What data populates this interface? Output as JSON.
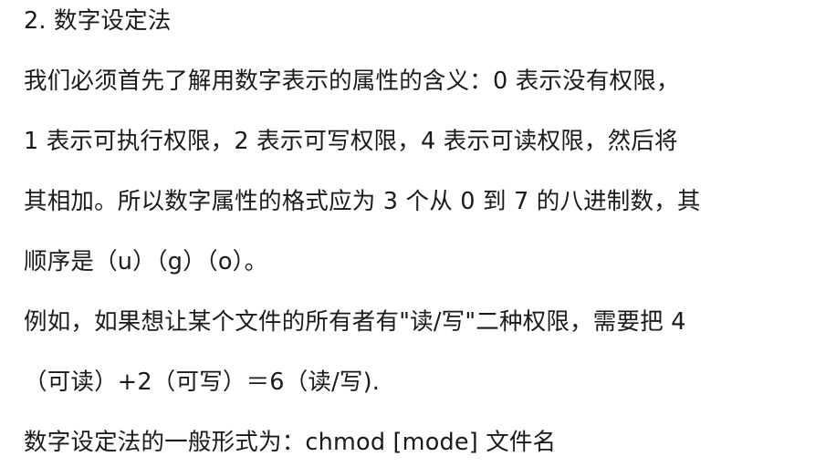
{
  "document": {
    "heading": "2.  数字设定法",
    "lines": [
      "我们必须首先了解用数字表示的属性的含义：0 表示没有权限，",
      "1 表示可执行权限，2 表示可写权限，4 表示可读权限，然后将",
      "其相加。所以数字属性的格式应为 3 个从 0 到 7 的八进制数，其",
      "顺序是（u）（g）（o）。",
      "例如，如果想让某个文件的所有者有\"读/写\"二种权限，需要把 4",
      "（可读）+2（可写）＝6（读/写).",
      "数字设定法的一般形式为：chmod [mode]  文件名"
    ]
  }
}
